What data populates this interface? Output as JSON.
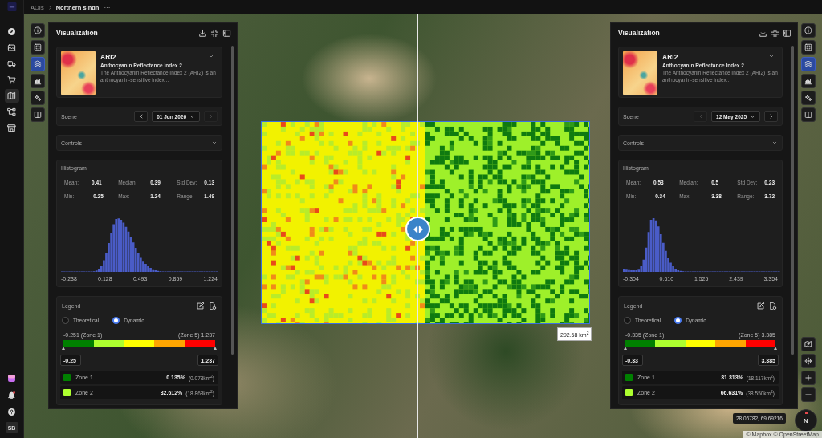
{
  "breadcrumb": {
    "items": [
      {
        "label": "AOIs",
        "current": false
      },
      {
        "label": "Northern sindh",
        "current": true
      }
    ],
    "more": "···"
  },
  "nav": {
    "items": [
      {
        "selected": false
      },
      {
        "selected": false
      },
      {
        "selected": false
      },
      {
        "selected": false
      },
      {
        "selected": true
      },
      {
        "selected": false
      },
      {
        "selected": false
      }
    ],
    "notifications": {
      "unread": true
    },
    "user_initials": "SB"
  },
  "toolbars": [
    {
      "items": [
        {
          "selected": false
        },
        {
          "selected": false
        },
        {
          "selected": true
        },
        {
          "selected": false
        },
        {
          "selected": false
        },
        {
          "selected": false
        }
      ]
    },
    {
      "items": [
        {
          "selected": false
        },
        {
          "selected": false
        },
        {
          "selected": true
        },
        {
          "selected": false
        },
        {
          "selected": false
        },
        {
          "selected": false
        }
      ]
    }
  ],
  "panels": [
    {
      "title": "Visualization",
      "index": {
        "code": "ARI2",
        "name": "Anthocyanin Reflectance Index 2",
        "description": "The Anthocyanin Reflectance Index 2 (ARI2) is an anthocyanin-sensitive index..."
      },
      "scene": {
        "label": "Scene",
        "date": "01 Jun 2026",
        "prev_disabled": false,
        "next_disabled": true
      },
      "controls_label": "Controls",
      "histogram": {
        "title": "Histogram",
        "stats": [
          {
            "label": "Mean:",
            "value": "0.41"
          },
          {
            "label": "Median:",
            "value": "0.39"
          },
          {
            "label": "Std Dev:",
            "value": "0.13"
          },
          {
            "label": "Min:",
            "value": "-0.25"
          },
          {
            "label": "Max:",
            "value": "1.24"
          },
          {
            "label": "Range:",
            "value": "1.49"
          }
        ],
        "axis_labels": [
          "-0.238",
          "0.128",
          "0.493",
          "0.859",
          "1.224"
        ]
      },
      "legend": {
        "title": "Legend",
        "modes": [
          {
            "label": "Theoretical",
            "selected": false
          },
          {
            "label": "Dynamic",
            "selected": true
          }
        ],
        "min_label": "-0.251 (Zone 1)",
        "max_label": "(Zone 5) 1.237",
        "scale": [
          {
            "color": "#008000"
          },
          {
            "color": "#adff2f"
          },
          {
            "color": "#ffff00"
          },
          {
            "color": "#ffa500"
          },
          {
            "color": "#ff0000"
          }
        ],
        "min_value": "-0.25",
        "max_value": "1.237",
        "zones": [
          {
            "name": "Zone 1",
            "color": "#008000",
            "percent": "0.135%",
            "area": "(0.078km$^{2}$)"
          },
          {
            "name": "Zone 2",
            "color": "#adff2f",
            "percent": "32.612%",
            "area": "(18.868km$^{2}$)"
          }
        ]
      }
    },
    {
      "title": "Visualization",
      "index": {
        "code": "ARI2",
        "name": "Anthocyanin Reflectance Index 2",
        "description": "The Anthocyanin Reflectance Index 2 (ARI2) is an anthocyanin-sensitive index..."
      },
      "scene": {
        "label": "Scene",
        "date": "12 May 2025",
        "prev_disabled": true,
        "next_disabled": false
      },
      "controls_label": "Controls",
      "histogram": {
        "title": "Histogram",
        "stats": [
          {
            "label": "Mean:",
            "value": "0.53"
          },
          {
            "label": "Median:",
            "value": "0.5"
          },
          {
            "label": "Std Dev:",
            "value": "0.23"
          },
          {
            "label": "Min:",
            "value": "-0.34"
          },
          {
            "label": "Max:",
            "value": "3.38"
          },
          {
            "label": "Range:",
            "value": "3.72"
          }
        ],
        "axis_labels": [
          "-0.304",
          "0.610",
          "1.525",
          "2.439",
          "3.354"
        ]
      },
      "legend": {
        "title": "Legend",
        "modes": [
          {
            "label": "Theoretical",
            "selected": false
          },
          {
            "label": "Dynamic",
            "selected": true
          }
        ],
        "min_label": "-0.335 (Zone 1)",
        "max_label": "(Zone 5) 3.385",
        "scale": [
          {
            "color": "#008000"
          },
          {
            "color": "#adff2f"
          },
          {
            "color": "#ffff00"
          },
          {
            "color": "#ffa500"
          },
          {
            "color": "#ff0000"
          }
        ],
        "min_value": "-0.33",
        "max_value": "3.385",
        "zones": [
          {
            "name": "Zone 1",
            "color": "#008000",
            "percent": "31.313%",
            "area": "(18.117km$^{2}$)"
          },
          {
            "name": "Zone 2",
            "color": "#adff2f",
            "percent": "66.631%",
            "area": "(38.550km$^{2}$)"
          }
        ]
      }
    }
  ],
  "map": {
    "area_label": "292.68 km$^{2}$",
    "coordinates": "28.06782, 69.69216",
    "compass_label": "N",
    "attribution": "© Mapbox © OpenStreetMap"
  }
}
